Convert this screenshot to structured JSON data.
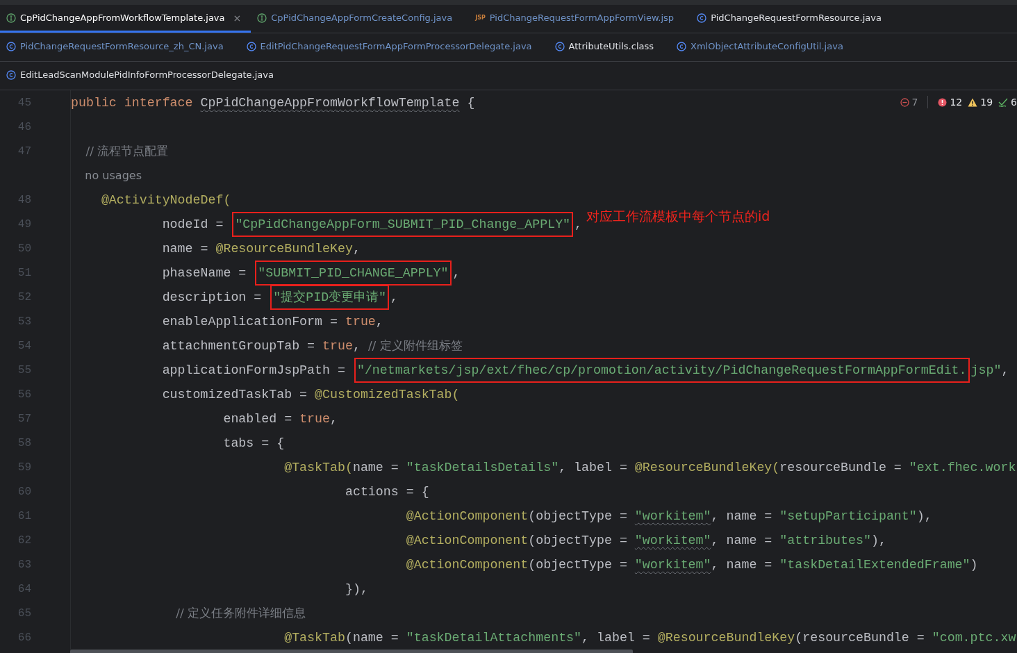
{
  "tab_rows": [
    [
      {
        "label": "CpPidChangeAppFromWorkflowTemplate.java",
        "kind": "interface",
        "selected": true,
        "modified": false,
        "close": "×"
      },
      {
        "label": "CpPidChangeAppFormCreateConfig.java",
        "kind": "interface",
        "selected": false,
        "modified": true
      },
      {
        "label": "PidChangeRequestFormAppFormView.jsp",
        "kind": "jsp",
        "icon_text": "JSP",
        "selected": false,
        "modified": true
      },
      {
        "label": "PidChangeRequestFormResource.java",
        "kind": "class",
        "selected": false,
        "modified": false
      }
    ],
    [
      {
        "label": "PidChangeRequestFormResource_zh_CN.java",
        "kind": "class",
        "selected": false,
        "modified": true
      },
      {
        "label": "EditPidChangeRequestFormAppFormProcessorDelegate.java",
        "kind": "class",
        "selected": false,
        "modified": true
      },
      {
        "label": "AttributeUtils.class",
        "kind": "class",
        "selected": false,
        "modified": false
      },
      {
        "label": "XmlObjectAttributeConfigUtil.java",
        "kind": "class",
        "selected": false,
        "modified": true
      }
    ],
    [
      {
        "label": "EditLeadScanModulePidInfoFormProcessorDelegate.java",
        "kind": "class",
        "selected": false,
        "modified": false
      }
    ]
  ],
  "inspections": [
    {
      "kind": "minus",
      "count": "7"
    },
    {
      "kind": "error",
      "count": "12"
    },
    {
      "kind": "warning",
      "count": "19"
    },
    {
      "kind": "ok",
      "count": "6"
    }
  ],
  "lines": [
    {
      "kind": "code",
      "number": "45",
      "tokens": [
        {
          "text": "public interface ",
          "kind": "keyword"
        },
        {
          "text": "CpPidChangeAppFromWorkflowTemplate",
          "kind": "plain",
          "wavy": true
        },
        {
          "text": " {",
          "kind": "plain"
        }
      ]
    },
    {
      "kind": "code",
      "number": "46"
    },
    {
      "kind": "code",
      "number": "47",
      "tokens": [
        {
          "text": "    // 流程节点配置",
          "kind": "comment"
        }
      ]
    },
    {
      "kind": "hint",
      "text": "    no usages"
    },
    {
      "kind": "code",
      "number": "48",
      "tokens": [
        {
          "text": "    @ActivityNodeDef(",
          "kind": "annotation"
        }
      ]
    },
    {
      "kind": "code",
      "number": "49",
      "tokens": [
        {
          "text": "            nodeId = ",
          "kind": "plain"
        },
        {
          "text": "\"CpPidChangeAppForm_SUBMIT_PID_Change_APPLY\"",
          "kind": "string",
          "boxed": true
        },
        {
          "text": ",",
          "kind": "plain"
        },
        {
          "text": "对应工作流模板中每个节点的id",
          "kind": "note"
        }
      ]
    },
    {
      "kind": "code",
      "number": "50",
      "tokens": [
        {
          "text": "            name = ",
          "kind": "plain"
        },
        {
          "text": "@ResourceBundleKey",
          "kind": "annotation"
        },
        {
          "text": ",",
          "kind": "plain"
        }
      ]
    },
    {
      "kind": "code",
      "number": "51",
      "tokens": [
        {
          "text": "            phaseName = ",
          "kind": "plain"
        },
        {
          "text": "\"SUBMIT_PID_CHANGE_APPLY\"",
          "kind": "string",
          "boxed": true
        },
        {
          "text": ",",
          "kind": "plain"
        }
      ]
    },
    {
      "kind": "code",
      "number": "52",
      "tokens": [
        {
          "text": "            description = ",
          "kind": "plain"
        },
        {
          "text": "\"提交PID变更申请\"",
          "kind": "string",
          "boxed": true
        },
        {
          "text": ",",
          "kind": "plain"
        }
      ]
    },
    {
      "kind": "code",
      "number": "53",
      "tokens": [
        {
          "text": "            enableApplicationForm = ",
          "kind": "plain"
        },
        {
          "text": "true",
          "kind": "keyword"
        },
        {
          "text": ",",
          "kind": "plain"
        }
      ]
    },
    {
      "kind": "code",
      "number": "54",
      "tokens": [
        {
          "text": "            attachmentGroupTab = ",
          "kind": "plain"
        },
        {
          "text": "true",
          "kind": "keyword"
        },
        {
          "text": ", ",
          "kind": "plain"
        },
        {
          "text": "// 定义附件组标签",
          "kind": "comment"
        }
      ]
    },
    {
      "kind": "code",
      "number": "55",
      "tokens": [
        {
          "text": "            applicationFormJspPath = ",
          "kind": "plain"
        },
        {
          "text": "\"/netmarkets/jsp/ext/fhec/cp/promotion/activity/PidChangeRequestFormAppFormEdit.",
          "kind": "string",
          "boxed": true
        },
        {
          "text": "jsp\"",
          "kind": "string"
        },
        {
          "text": ",",
          "kind": "plain"
        }
      ]
    },
    {
      "kind": "code",
      "number": "56",
      "tokens": [
        {
          "text": "            customizedTaskTab = ",
          "kind": "plain"
        },
        {
          "text": "@CustomizedTaskTab(",
          "kind": "annotation"
        }
      ]
    },
    {
      "kind": "code",
      "number": "57",
      "tokens": [
        {
          "text": "                    enabled = ",
          "kind": "plain"
        },
        {
          "text": "true",
          "kind": "keyword"
        },
        {
          "text": ",",
          "kind": "plain"
        }
      ]
    },
    {
      "kind": "code",
      "number": "58",
      "tokens": [
        {
          "text": "                    tabs = {",
          "kind": "plain"
        }
      ]
    },
    {
      "kind": "code",
      "number": "59",
      "tokens": [
        {
          "text": "                            @TaskTab(",
          "kind": "annotation"
        },
        {
          "text": "name = ",
          "kind": "plain"
        },
        {
          "text": "\"taskDetailsDetails\"",
          "kind": "string"
        },
        {
          "text": ", label = ",
          "kind": "plain"
        },
        {
          "text": "@ResourceBundleKey(",
          "kind": "annotation"
        },
        {
          "text": "resourceBundle = ",
          "kind": "plain"
        },
        {
          "text": "\"ext.fhec.work",
          "kind": "string"
        }
      ]
    },
    {
      "kind": "code",
      "number": "60",
      "tokens": [
        {
          "text": "                                    actions = {",
          "kind": "plain"
        }
      ]
    },
    {
      "kind": "code",
      "number": "61",
      "tokens": [
        {
          "text": "                                            @ActionComponent",
          "kind": "annotation"
        },
        {
          "text": "(objectType = ",
          "kind": "plain"
        },
        {
          "text": "\"workitem\"",
          "kind": "string",
          "wavy": true
        },
        {
          "text": ", name = ",
          "kind": "plain"
        },
        {
          "text": "\"setupParticipant\"",
          "kind": "string"
        },
        {
          "text": "),",
          "kind": "plain"
        }
      ]
    },
    {
      "kind": "code",
      "number": "62",
      "tokens": [
        {
          "text": "                                            @ActionComponent",
          "kind": "annotation"
        },
        {
          "text": "(objectType = ",
          "kind": "plain"
        },
        {
          "text": "\"workitem\"",
          "kind": "string",
          "wavy": true
        },
        {
          "text": ", name = ",
          "kind": "plain"
        },
        {
          "text": "\"attributes\"",
          "kind": "string"
        },
        {
          "text": "),",
          "kind": "plain"
        }
      ]
    },
    {
      "kind": "code",
      "number": "63",
      "tokens": [
        {
          "text": "                                            @ActionComponent",
          "kind": "annotation"
        },
        {
          "text": "(objectType = ",
          "kind": "plain"
        },
        {
          "text": "\"workitem\"",
          "kind": "string",
          "wavy": true
        },
        {
          "text": ", name = ",
          "kind": "plain"
        },
        {
          "text": "\"taskDetailExtendedFrame\"",
          "kind": "string"
        },
        {
          "text": ")",
          "kind": "plain"
        }
      ]
    },
    {
      "kind": "code",
      "number": "64",
      "tokens": [
        {
          "text": "                                    }),",
          "kind": "plain"
        }
      ]
    },
    {
      "kind": "code",
      "number": "65",
      "tokens": [
        {
          "text": "                            // 定义任务附件详细信息",
          "kind": "comment"
        }
      ]
    },
    {
      "kind": "code",
      "number": "66",
      "tokens": [
        {
          "text": "                            @TaskTab",
          "kind": "annotation"
        },
        {
          "text": "(name = ",
          "kind": "plain"
        },
        {
          "text": "\"taskDetailAttachments\"",
          "kind": "string"
        },
        {
          "text": ", label = ",
          "kind": "plain"
        },
        {
          "text": "@ResourceBundleKey",
          "kind": "annotation"
        },
        {
          "text": "(resourceBundle = ",
          "kind": "plain"
        },
        {
          "text": "\"com.ptc.xw",
          "kind": "string"
        }
      ]
    }
  ]
}
